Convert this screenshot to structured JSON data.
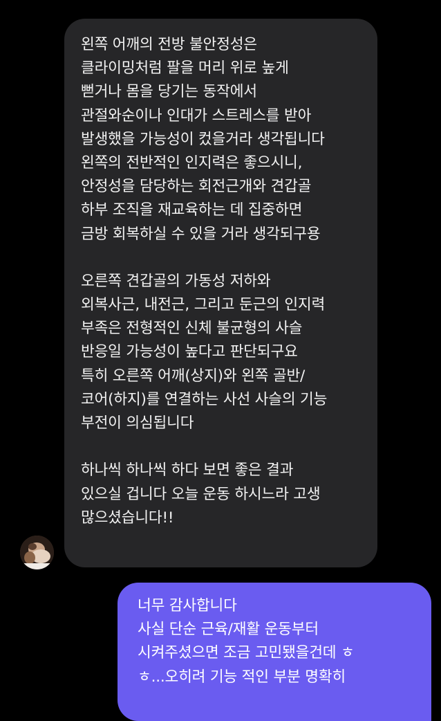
{
  "conversation": {
    "incoming_message": {
      "lines": [
        "왼쪽 어깨의 전방 불안정성은",
        "클라이밍처럼 팔을 머리 위로 높게",
        "뻗거나 몸을 당기는 동작에서",
        "관절와순이나 인대가 스트레스를 받아",
        "발생했을 가능성이 컸을거라 생각됩니다",
        "왼쪽의 전반적인 인지력은 좋으시니,",
        "안정성을 담당하는 회전근개와 견갑골",
        "하부 조직을 재교육하는 데 집중하면",
        "금방 회복하실 수 있을 거라 생각되구용",
        "",
        "오른쪽 견갑골의 가동성 저하와",
        "외복사근, 내전근, 그리고 둔근의 인지력",
        "부족은 전형적인 신체 불균형의 사슬",
        "반응일 가능성이 높다고 판단되구요",
        "특히 오른쪽 어깨(상지)와 왼쪽 골반/",
        "코어(하지)를 연결하는 사선 사슬의 기능",
        "부전이 의심됩니다",
        "",
        "하나씩 하나씩 하다 보면 좋은 결과",
        "있으실 겁니다 오늘 운동 하시느라 고생",
        "많으셨습니다!!"
      ]
    },
    "outgoing_message": {
      "lines": [
        "너무 감사합니다",
        "사실 단순 근육/재활 운동부터",
        "시켜주셨으면 조금 고민됐을건데 ㅎ",
        "ㅎ...오히려 기능 적인 부분 명확히"
      ]
    },
    "colors": {
      "background": "#000000",
      "incoming_bubble": "#262628",
      "outgoing_bubble": "#6a5cf0",
      "text": "#f2f2f2"
    },
    "avatar": {
      "icon": "profile-photo"
    }
  }
}
